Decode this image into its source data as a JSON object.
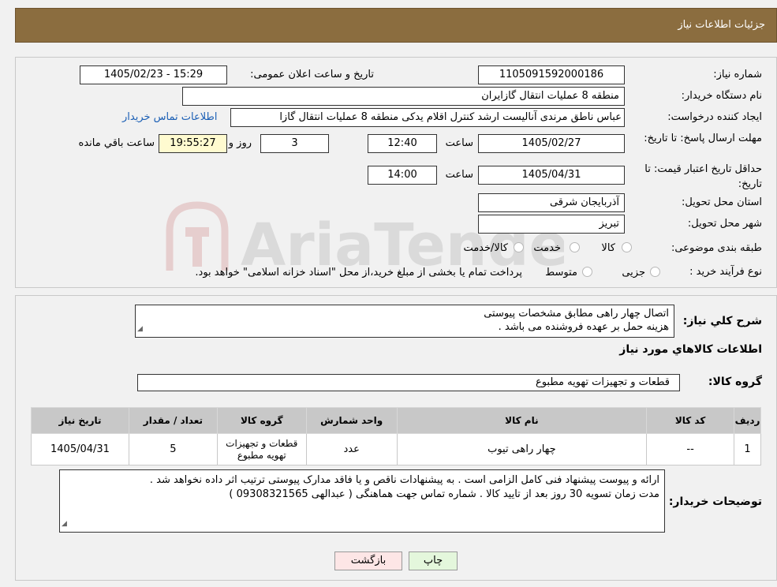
{
  "header": {
    "title": "جزئیات اطلاعات نیاز"
  },
  "form": {
    "need_number_label": "شماره نیاز:",
    "need_number": "1105091592000186",
    "announce_label": "تاریخ و ساعت اعلان عمومی:",
    "announce_value": "1405/02/23 - 15:29",
    "buyer_org_label": "نام دستگاه خریدار:",
    "buyer_org": "منطقه 8 عملیات انتقال گازایران",
    "creator_label": "ایجاد کننده درخواست:",
    "creator": "عباس ناطق مرندی آنالیست ارشد کنترل اقلام یدکی منطقه 8 عملیات انتقال گازا",
    "contact_link": "اطلاعات تماس خریدار",
    "deadline_label": "مهلت ارسال پاسخ: تا تاریخ:",
    "deadline_date": "1405/02/27",
    "time_label": "ساعت",
    "deadline_time": "12:40",
    "days_value": "3",
    "days_label": "روز و",
    "remaining_time": "19:55:27",
    "remaining_label": "ساعت باقي مانده",
    "validity_label": "حداقل تاریخ اعتبار قیمت: تا تاریخ:",
    "validity_date": "1405/04/31",
    "validity_time": "14:00",
    "province_label": "استان محل تحویل:",
    "province": "آذربایجان شرقی",
    "city_label": "شهر محل تحویل:",
    "city": "تبریز",
    "category_label": "طبقه بندی موضوعی:",
    "category_options": [
      "کالا",
      "خدمت",
      "کالا/خدمت"
    ],
    "process_label": "نوع فرآیند خرید :",
    "process_options": [
      "جزیی",
      "متوسط"
    ],
    "process_note": "پرداخت تمام یا بخشی از مبلغ خرید،از محل \"اسناد خزانه اسلامی\" خواهد بود."
  },
  "summary": {
    "label": "شرح کلي نياز:",
    "text_line1": "اتصال چهار راهی مطابق مشخصات پیوستی",
    "text_line2": "هزینه حمل بر عهده فروشنده می باشد ."
  },
  "goods": {
    "section_title": "اطلاعات کالاهاي مورد نياز",
    "group_label": "گروه کالا:",
    "group_value": "قطعات و تجهیزات تهویه مطبوع",
    "columns": [
      "رديف",
      "کد کالا",
      "نام کالا",
      "واحد شمارش",
      "گروه کالا",
      "تعداد / مقدار",
      "تاریخ نیاز"
    ],
    "rows": [
      [
        "1",
        "--",
        "چهار راهی تیوب",
        "عدد",
        "قطعات و تجهیزات تهویه مطبوع",
        "5",
        "1405/04/31"
      ]
    ]
  },
  "buyer_notes": {
    "label": "توضیحات خریدار:",
    "line1": "ارائه و پیوست پیشنهاد فنی کامل الزامی است . به پیشنهادات ناقص  و یا فاقد مدارک پیوستی ترتیب اثر داده نخواهد شد .",
    "line2": "مدت زمان تسویه 30 روز بعد از تایید کالا . شماره تماس جهت هماهنگی ( عبدالهی 09308321565 )"
  },
  "buttons": {
    "print": "چاپ",
    "back": "بازگشت"
  },
  "watermark": {
    "text": "AriaTender.neT"
  },
  "colors": {
    "header_bg": "#8b6d3f",
    "link": "#1b5fb5",
    "remaining_bg": "#fffbd0",
    "print_bg": "#e4f7dc",
    "back_bg": "#fde6e6"
  }
}
